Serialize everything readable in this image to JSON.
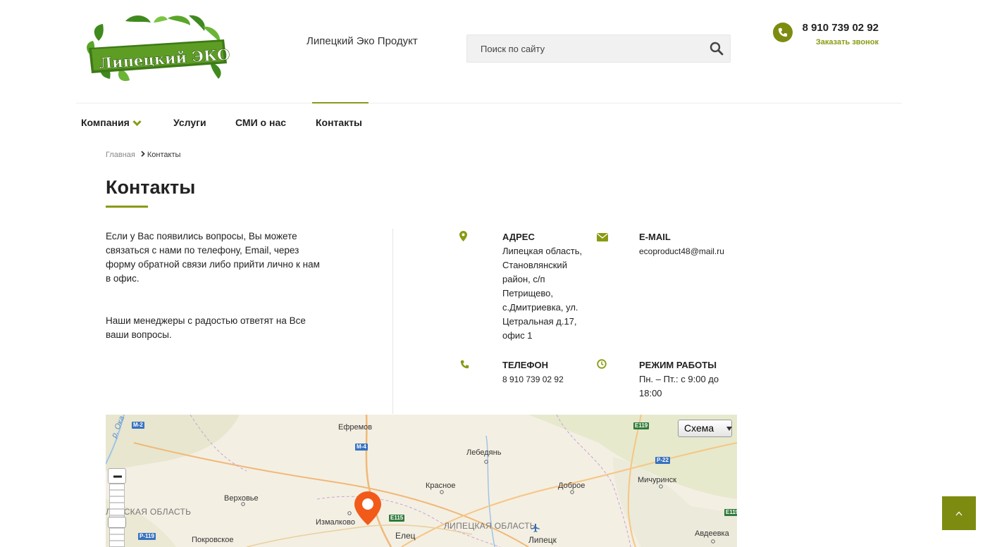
{
  "header": {
    "logo_text": "Липецкий ЭКО продукт",
    "site_name": "Липецкий Эко Продукт",
    "search_placeholder": "Поиск по сайту",
    "phone": "8 910 739 02 92",
    "callback_label": "Заказать звонок"
  },
  "nav": {
    "items": [
      "Компания",
      "Услуги",
      "СМИ о нас",
      "Контакты"
    ],
    "active": "Контакты"
  },
  "breadcrumb": {
    "home": "Главная",
    "current": "Контакты"
  },
  "page": {
    "title": "Контакты",
    "intro_p1": "Если у Вас появились вопросы, Вы можете связаться с нами по телефону, Email, через форму обратной связи либо прийти лично к нам в офис.",
    "intro_p2": "Наши менеджеры с радостью ответят на Все ваши вопросы."
  },
  "contacts": {
    "address_label": "АДРЕС",
    "address_value": "Липецкая область, Становлянский район, с/п Петрищево, с.Дмитриевка, ул. Цетральная д.17, офис 1",
    "email_label": "E-MAIL",
    "email_value": "ecoproduct48@mail.ru",
    "phone_label": "ТЕЛЕФОН",
    "phone_value": "8 910 739 02 92",
    "hours_label": "РЕЖИМ РАБОТЫ",
    "hours_value": "Пн. – Пт.: с 9:00 до 18:00"
  },
  "map": {
    "type_button": "Схема",
    "places": [
      "Ефремов",
      "Лебедянь",
      "Мичуринск",
      "Верховье",
      "Красное",
      "Доброе",
      "Измалково",
      "Елец",
      "Липецк",
      "Покровское",
      "Авдеевка"
    ],
    "regions": [
      "ЛОВСКАЯ ОБЛАСТЬ",
      "ЛИПЕЦКАЯ ОБЛАСТЬ"
    ],
    "river": "р. Ока",
    "roads": [
      "M-2",
      "M-4",
      "E119",
      "P-22",
      "E115",
      "P-119",
      "E119"
    ]
  },
  "colors": {
    "accent": "#8a9a12",
    "accent_dark": "#7d8c10",
    "map_pin": "#f25a1a"
  }
}
